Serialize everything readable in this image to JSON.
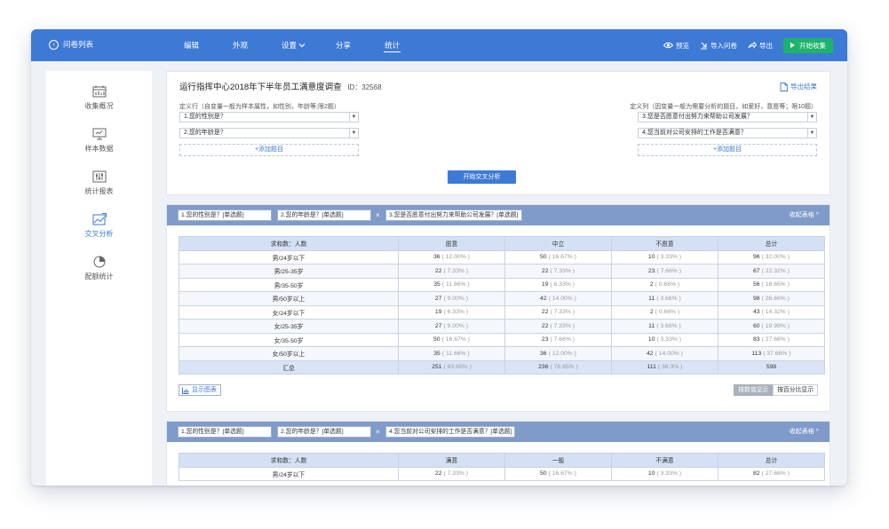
{
  "topbar": {
    "back_label": "问卷列表",
    "tabs": [
      {
        "label": "编辑"
      },
      {
        "label": "外观"
      },
      {
        "label": "设置"
      },
      {
        "label": "分享"
      },
      {
        "label": "统计"
      }
    ],
    "active_tab": "统计",
    "actions": {
      "preview": "预览",
      "import": "导入问卷",
      "export": "导出",
      "start": "开始收集"
    }
  },
  "sidebar": {
    "items": [
      {
        "label": "收集概况",
        "icon": "calendar-chart-icon"
      },
      {
        "label": "样本数据",
        "icon": "monitor-icon"
      },
      {
        "label": "统计报表",
        "icon": "sliders-icon"
      },
      {
        "label": "交叉分析",
        "icon": "image-chart-icon"
      },
      {
        "label": "配额统计",
        "icon": "pie-icon"
      }
    ],
    "active": "交叉分析"
  },
  "config": {
    "title": "运行指挥中心2018年下半年员工满意度调查",
    "id_text": "ID：32568",
    "export_result": "导出结果",
    "row_label": "定义行（自变量一般为样本属性，如性别，年龄等;限2题）",
    "col_label": "定义列（因变量一般为需要分析的题目，如爱好，意愿等；限10题）",
    "row_questions": [
      "1.您的性别是？",
      "2.您的年龄是？"
    ],
    "col_questions": [
      "3.您是否愿意付出努力来帮助公司发展？",
      "4.您当前对公司安排的工作是否满意？"
    ],
    "add_question": "+添加题目",
    "start_cross": "开始交叉分析"
  },
  "cards": [
    {
      "chips": [
        "1.您的性别是？[单选题]",
        "2.您的年龄是？[单选题]",
        "3.您是否愿意付出努力来帮助公司发展？[单选题]"
      ],
      "x": "×",
      "collapse": "收起表格 ^",
      "headers": [
        "求和数：人数",
        "愿意",
        "中立",
        "不愿意",
        "总计"
      ],
      "rows": [
        {
          "label": "男/24岁以下",
          "cells": [
            [
              "36",
              "( 12.00% )"
            ],
            [
              "50",
              "( 16.67% )"
            ],
            [
              "10",
              "( 3.33% )"
            ],
            [
              "96",
              "( 32.00% )"
            ]
          ]
        },
        {
          "label": "男/25-35岁",
          "cells": [
            [
              "22",
              "( 7.33% )"
            ],
            [
              "22",
              "( 7.33% )"
            ],
            [
              "23",
              "( 7.66% )"
            ],
            [
              "67",
              "( 22.32% )"
            ]
          ]
        },
        {
          "label": "男/35-50岁",
          "cells": [
            [
              "35",
              "( 11.66% )"
            ],
            [
              "19",
              "( 6.33% )"
            ],
            [
              "2",
              "( 0.66% )"
            ],
            [
              "56",
              "( 18.65% )"
            ]
          ]
        },
        {
          "label": "男/50岁以上",
          "cells": [
            [
              "27",
              "( 9.00% )"
            ],
            [
              "42",
              "( 14.00% )"
            ],
            [
              "11",
              "( 3.66% )"
            ],
            [
              "98",
              "( 26.66% )"
            ]
          ]
        },
        {
          "label": "女/24岁以下",
          "cells": [
            [
              "19",
              "( 6.33% )"
            ],
            [
              "22",
              "( 7.33% )"
            ],
            [
              "2",
              "( 0.66% )"
            ],
            [
              "43",
              "( 14.32% )"
            ]
          ]
        },
        {
          "label": "女/25-35岁",
          "cells": [
            [
              "27",
              "( 9.00% )"
            ],
            [
              "22",
              "( 7.33% )"
            ],
            [
              "11",
              "( 3.66% )"
            ],
            [
              "60",
              "( 19.99% )"
            ]
          ]
        },
        {
          "label": "女/35-50岁",
          "cells": [
            [
              "50",
              "( 16.67% )"
            ],
            [
              "23",
              "( 7.66% )"
            ],
            [
              "10",
              "( 3.33% )"
            ],
            [
              "83",
              "( 27.66% )"
            ]
          ]
        },
        {
          "label": "女/50岁以上",
          "cells": [
            [
              "35",
              "( 11.66% )"
            ],
            [
              "36",
              "( 12.00% )"
            ],
            [
              "42",
              "( 14.00% )"
            ],
            [
              "113",
              "( 37.66% )"
            ]
          ]
        },
        {
          "label": "汇总",
          "cells": [
            [
              "251",
              "( 83.65% )"
            ],
            [
              "236",
              "( 78.65% )"
            ],
            [
              "111",
              "( 36.3% )"
            ],
            [
              "598",
              ""
            ]
          ],
          "sum": true
        }
      ],
      "show_chart": "显示图表",
      "toggle_value": "按数值显示",
      "toggle_percent": "按百分比显示"
    },
    {
      "chips": [
        "1.您的性别是？[单选题]",
        "2.您的年龄是？[单选题]",
        "4.您当前对公司安排的工作是否满意？[单选题]"
      ],
      "x": "×",
      "collapse": "收起表格 ^",
      "headers": [
        "求和数：人数",
        "满意",
        "一般",
        "不满意",
        "总计"
      ],
      "rows": [
        {
          "label": "男/24岁以下",
          "cells": [
            [
              "22",
              "( 7.33% )"
            ],
            [
              "50",
              "( 16.67% )"
            ],
            [
              "10",
              "( 3.33% )"
            ],
            [
              "82",
              "( 27.66% )"
            ]
          ]
        }
      ]
    }
  ]
}
